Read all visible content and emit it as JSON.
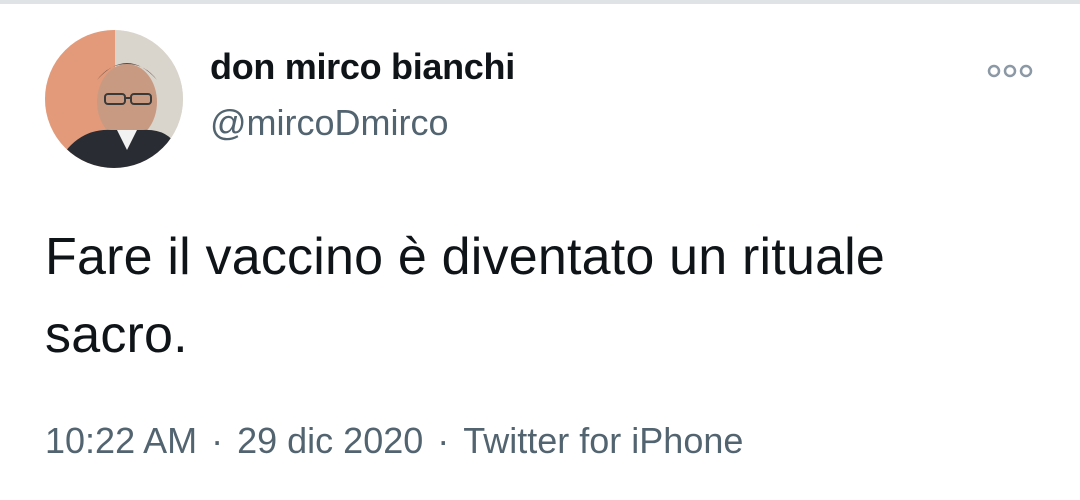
{
  "tweet": {
    "author": {
      "display_name": "don mirco bianchi",
      "handle": "@mircoDmirco",
      "avatar": "profile-photo"
    },
    "more_icon": "more-options-icon",
    "text": "Fare il vaccino è diventato un rituale sacro.",
    "time": "10:22 AM",
    "date": "29 dic 2020",
    "separator": "·",
    "source": "Twitter for iPhone"
  },
  "colors": {
    "text_primary": "#0f1419",
    "text_secondary": "#536471",
    "more_icon": "#8b98a5"
  }
}
